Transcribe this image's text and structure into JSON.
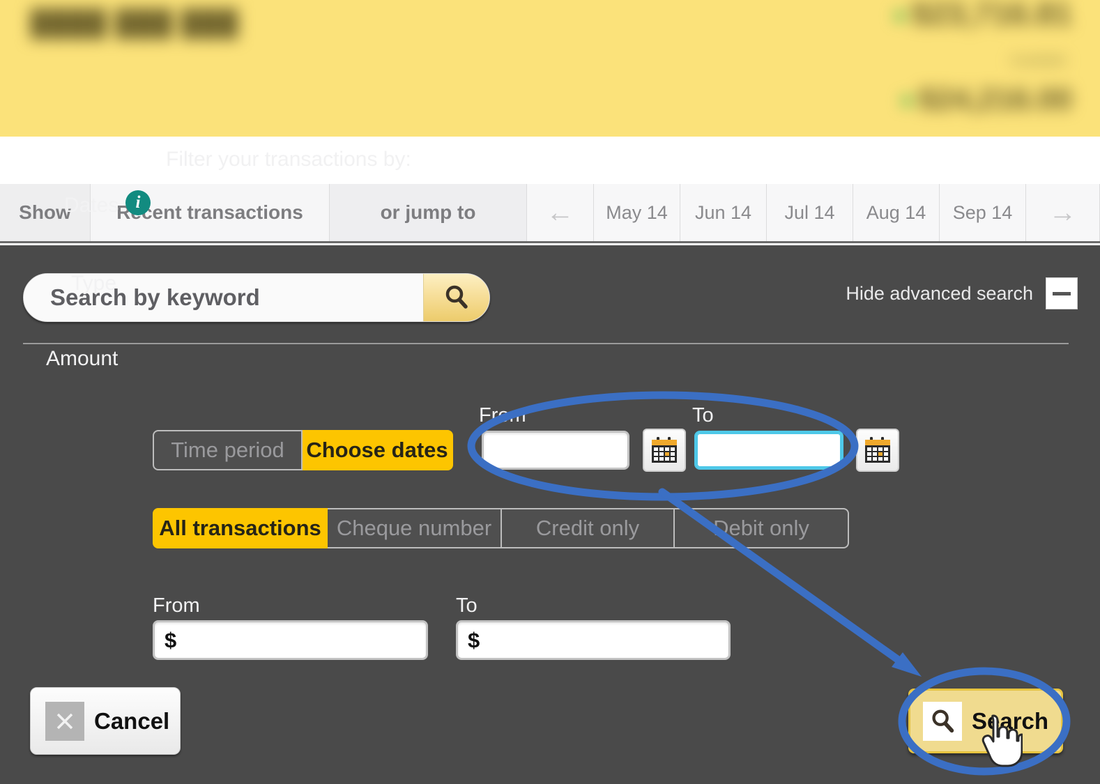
{
  "banner": {
    "account_masked": "████ ███ ███",
    "balance_masked": "$23,716.81",
    "available_label_masked": "Available",
    "available_masked": "$24,216.00"
  },
  "tabstrip": {
    "show_label": "Show",
    "recent_tab": "Recent transactions",
    "jump_to_label": "or jump to",
    "prev_arrow": "←",
    "next_arrow": "→",
    "months": [
      "May 14",
      "Jun 14",
      "Jul 14",
      "Aug 14",
      "Sep 14"
    ]
  },
  "search": {
    "keyword_value": "",
    "keyword_placeholder": "Search by keyword",
    "search_icon": "magnifier-icon",
    "hide_advanced_label": "Hide advanced search",
    "collapse_icon": "minus-icon"
  },
  "filters": {
    "title": "Filter your transactions by:",
    "dates": {
      "label": "Dates",
      "info_icon": "info-icon",
      "info_glyph": "i",
      "options": [
        "Time period",
        "Choose dates"
      ],
      "selected": "Choose dates",
      "from_label": "From",
      "to_label": "To",
      "from_value": "",
      "to_value": "",
      "from_calendar_icon": "calendar-icon",
      "to_calendar_icon": "calendar-icon",
      "focused_field": "To"
    },
    "type": {
      "label": "Type",
      "options": [
        "All transactions",
        "Cheque number",
        "Credit only",
        "Debit only"
      ],
      "selected": "All transactions"
    },
    "amount": {
      "label": "Amount",
      "from_label": "From",
      "to_label": "To",
      "currency_prefix": "$",
      "from_value": "",
      "to_value": ""
    }
  },
  "actions": {
    "cancel_label": "Cancel",
    "cancel_icon": "close-x-icon",
    "search_label": "Search",
    "search_icon": "magnifier-icon"
  },
  "annotations": {
    "highlight_color": "#3b6fc4",
    "ellipse_dates": "date-fields-highlight",
    "ellipse_search": "search-button-highlight",
    "arrow": "arrow-dates-to-search",
    "cursor": "hand-cursor"
  },
  "colors": {
    "panel_bg": "#4a4a4a",
    "accent_yellow": "#fdc500",
    "banner_yellow": "#fbe27a",
    "focus_cyan": "#4ec8e8",
    "info_teal": "#128b80",
    "annotation_blue": "#3b6fc4"
  }
}
